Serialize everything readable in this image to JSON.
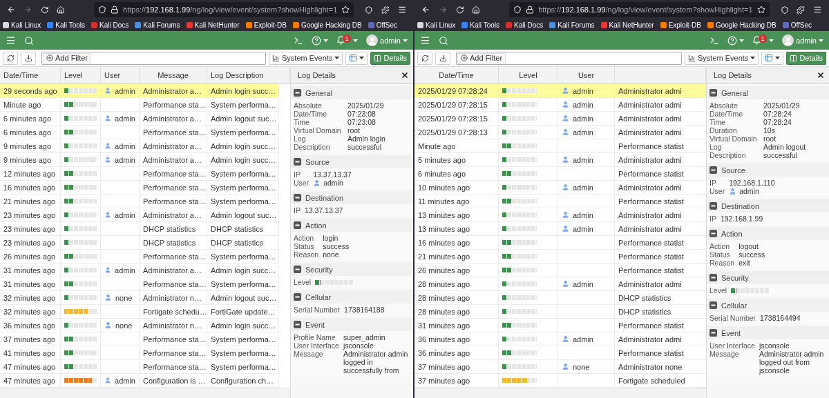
{
  "windows": [
    {
      "browser": {
        "url": "https://**192.168.1.99**/ng/log/view/event/system?showHighlight=1",
        "bookmarks": [
          {
            "label": "Kali Linux",
            "color": "#d9d9d9"
          },
          {
            "label": "Kali Tools",
            "color": "#3b82f6"
          },
          {
            "label": "Kali Docs",
            "color": "#d32f2f"
          },
          {
            "label": "Kali Forums",
            "color": "#4a90e2"
          },
          {
            "label": "Kali NetHunter",
            "color": "#e53935"
          },
          {
            "label": "Exploit-DB",
            "color": "#f57c00"
          },
          {
            "label": "Google Hacking DB",
            "color": "#f57c00"
          },
          {
            "label": "OffSec",
            "color": "#5c6bc0"
          }
        ]
      },
      "header": {
        "notifications": "1",
        "user": "admin"
      },
      "toolbar": {
        "filter_button": "Add Filter",
        "view_menu": "System Events",
        "details_button": "Details"
      },
      "table": {
        "columns": [
          "Date/Time",
          "Level",
          "User",
          "Message",
          "Log Description"
        ],
        "rows": [
          {
            "date": "29 seconds ago",
            "level": 0.143,
            "user": "admin",
            "message": "Administrator a…",
            "description": "Admin login succ…",
            "selected": true
          },
          {
            "date": "Minute ago",
            "level": 0.286,
            "message": "Performance sta…",
            "description": "System performa…",
            "selected": false
          },
          {
            "date": "6 minutes ago",
            "level": 0.143,
            "user": "admin",
            "message": "Administrator a…",
            "description": "Admin logout suc…",
            "selected": false
          },
          {
            "date": "6 minutes ago",
            "level": 0.286,
            "message": "Performance sta…",
            "description": "System performa…",
            "selected": false
          },
          {
            "date": "9 minutes ago",
            "level": 0.143,
            "user": "admin",
            "message": "Administrator a…",
            "description": "Admin login succ…",
            "selected": false
          },
          {
            "date": "9 minutes ago",
            "level": 0.143,
            "user": "admin",
            "message": "Administrator a…",
            "description": "Admin login succ…",
            "selected": false
          },
          {
            "date": "12 minutes ago",
            "level": 0.286,
            "message": "Performance sta…",
            "description": "System performa…",
            "selected": false
          },
          {
            "date": "16 minutes ago",
            "level": 0.286,
            "message": "Performance sta…",
            "description": "System performa…",
            "selected": false
          },
          {
            "date": "21 minutes ago",
            "level": 0.286,
            "message": "Performance sta…",
            "description": "System performa…",
            "selected": false
          },
          {
            "date": "23 minutes ago",
            "level": 0.143,
            "user": "admin",
            "message": "Administrator a…",
            "description": "Admin logout suc…",
            "selected": false
          },
          {
            "date": "23 minutes ago",
            "level": 0.143,
            "message": "DHCP statistics",
            "description": "DHCP statistics",
            "selected": false
          },
          {
            "date": "23 minutes ago",
            "level": 0.143,
            "message": "DHCP statistics",
            "description": "DHCP statistics",
            "selected": false
          },
          {
            "date": "26 minutes ago",
            "level": 0.286,
            "message": "Performance sta…",
            "description": "System performa…",
            "selected": false
          },
          {
            "date": "31 minutes ago",
            "level": 0.143,
            "user": "admin",
            "message": "Administrator a…",
            "description": "Admin login succ…",
            "selected": false
          },
          {
            "date": "31 minutes ago",
            "level": 0.286,
            "message": "Performance sta…",
            "description": "System performa…",
            "selected": false
          },
          {
            "date": "32 minutes ago",
            "level": 0.143,
            "user": "none",
            "message": "Administrator n…",
            "description": "Admin logout suc…",
            "selected": false
          },
          {
            "date": "32 minutes ago",
            "level": 0.714,
            "message": "Fortigate schedu…",
            "description": "FortiGate update…",
            "selected": false
          },
          {
            "date": "36 minutes ago",
            "level": 0.143,
            "user": "none",
            "message": "Administrator n…",
            "description": "Admin login succ…",
            "selected": false
          },
          {
            "date": "37 minutes ago",
            "level": 0.286,
            "message": "Performance sta…",
            "description": "System performa…",
            "selected": false
          },
          {
            "date": "41 minutes ago",
            "level": 0.286,
            "message": "Performance sta…",
            "description": "System performa…",
            "selected": false
          },
          {
            "date": "47 minutes ago",
            "level": 0.286,
            "message": "Performance sta…",
            "description": "System performa…",
            "selected": false
          },
          {
            "date": "47 minutes ago",
            "level": 0.857,
            "user": "admin",
            "message": "Configuration is …",
            "description": "Configuration ch…",
            "selected": false
          }
        ]
      },
      "details": {
        "title": "Log Details",
        "sections": [
          {
            "title": "General",
            "fields": [
              {
                "kind": "text",
                "label": "Absolute Date/Time",
                "value": "2025/01/29 07:23:08"
              },
              {
                "kind": "text",
                "label": "Time",
                "value": "07:23:08"
              },
              {
                "kind": "text",
                "label": "Virtual Domain",
                "value": "root"
              },
              {
                "kind": "text",
                "label": "Log Description",
                "value": "Admin login successful"
              }
            ]
          },
          {
            "title": "Source",
            "fields": [
              {
                "kind": "text",
                "label": "IP",
                "value": "13.37.13.37"
              },
              {
                "kind": "user",
                "label": "User",
                "value": "admin"
              }
            ]
          },
          {
            "title": "Destination",
            "fields": [
              {
                "kind": "text",
                "label": "IP",
                "value": "13.37.13.37"
              }
            ]
          },
          {
            "title": "Action",
            "fields": [
              {
                "kind": "text",
                "label": "Action",
                "value": "login"
              },
              {
                "kind": "text",
                "label": "Status",
                "value": "success"
              },
              {
                "kind": "text",
                "label": "Reason",
                "value": "none"
              }
            ]
          },
          {
            "title": "Security",
            "fields": [
              {
                "kind": "level",
                "label": "Level",
                "level": 0.143
              }
            ]
          },
          {
            "title": "Cellular",
            "fields": [
              {
                "kind": "text",
                "label": "Serial Number",
                "value": "1738164188"
              }
            ]
          },
          {
            "title": "Event",
            "fields": [
              {
                "kind": "text",
                "label": "Profile Name",
                "value": "super_admin"
              },
              {
                "kind": "text",
                "label": "User Interface",
                "value": "jsconsole"
              },
              {
                "kind": "text",
                "label": "Message",
                "value": "Administrator admin logged in successfully from"
              }
            ]
          }
        ]
      }
    },
    {
      "browser": {
        "url": "https://**192.168.1.99**/ng/log/view/event/system?showHighlight=1",
        "bookmarks": [
          {
            "label": "Kali Linux",
            "color": "#d9d9d9"
          },
          {
            "label": "Kali Tools",
            "color": "#3b82f6"
          },
          {
            "label": "Kali Docs",
            "color": "#d32f2f"
          },
          {
            "label": "Kali Forums",
            "color": "#4a90e2"
          },
          {
            "label": "Kali NetHunter",
            "color": "#e53935"
          },
          {
            "label": "Exploit-DB",
            "color": "#f57c00"
          },
          {
            "label": "Google Hacking DB",
            "color": "#f57c00"
          },
          {
            "label": "OffSec",
            "color": "#5c6bc0"
          }
        ]
      },
      "header": {
        "notifications": "1",
        "user": "admin"
      },
      "toolbar": {
        "filter_button": "Add Filter",
        "view_menu": "System Events",
        "details_button": "Details"
      },
      "table": {
        "columns": [
          "Date/Time",
          "Level",
          "User"
        ],
        "rows": [
          {
            "date": "2025/01/29 07:28:24",
            "level": 0.143,
            "user": "admin",
            "message": "Administrator admi",
            "selected": true
          },
          {
            "date": "2025/01/29 07:28:15",
            "level": 0.143,
            "user": "admin",
            "message": "Administrator admi",
            "selected": false
          },
          {
            "date": "2025/01/29 07:28:15",
            "level": 0.143,
            "user": "admin",
            "message": "Administrator admi",
            "selected": false
          },
          {
            "date": "2025/01/29 07:28:13",
            "level": 0.143,
            "user": "admin",
            "message": "Administrator admi",
            "selected": false
          },
          {
            "date": "Minute ago",
            "level": 0.286,
            "message": "Performance statist",
            "selected": false
          },
          {
            "date": "5 minutes ago",
            "level": 0.143,
            "user": "admin",
            "message": "Administrator admi",
            "selected": false
          },
          {
            "date": "6 minutes ago",
            "level": 0.286,
            "message": "Performance statist",
            "selected": false
          },
          {
            "date": "10 minutes ago",
            "level": 0.143,
            "user": "admin",
            "message": "Administrator admi",
            "selected": false
          },
          {
            "date": "11 minutes ago",
            "level": 0.286,
            "message": "Performance statist",
            "selected": false
          },
          {
            "date": "13 minutes ago",
            "level": 0.143,
            "user": "admin",
            "message": "Administrator admi",
            "selected": false
          },
          {
            "date": "13 minutes ago",
            "level": 0.143,
            "user": "admin",
            "message": "Administrator admi",
            "selected": false
          },
          {
            "date": "16 minutes ago",
            "level": 0.286,
            "message": "Performance statist",
            "selected": false
          },
          {
            "date": "21 minutes ago",
            "level": 0.286,
            "message": "Performance statist",
            "selected": false
          },
          {
            "date": "26 minutes ago",
            "level": 0.286,
            "message": "Performance statist",
            "selected": false
          },
          {
            "date": "28 minutes ago",
            "level": 0.143,
            "user": "admin",
            "message": "Administrator admi",
            "selected": false
          },
          {
            "date": "28 minutes ago",
            "level": 0.143,
            "message": "DHCP statistics",
            "selected": false
          },
          {
            "date": "28 minutes ago",
            "level": 0.143,
            "message": "DHCP statistics",
            "selected": false
          },
          {
            "date": "31 minutes ago",
            "level": 0.286,
            "message": "Performance statist",
            "selected": false
          },
          {
            "date": "36 minutes ago",
            "level": 0.143,
            "user": "admin",
            "message": "Administrator admi",
            "selected": false
          },
          {
            "date": "36 minutes ago",
            "level": 0.286,
            "message": "Performance statist",
            "selected": false
          },
          {
            "date": "37 minutes ago",
            "level": 0.143,
            "user": "none",
            "message": "Administrator none",
            "selected": false
          },
          {
            "date": "37 minutes ago",
            "level": 0.714,
            "message": "Fortigate scheduled",
            "selected": false
          }
        ]
      },
      "details": {
        "title": "Log Details",
        "sections": [
          {
            "title": "General",
            "fields": [
              {
                "kind": "text",
                "label": "Absolute Date/Time",
                "value": "2025/01/29 07:28:24"
              },
              {
                "kind": "text",
                "label": "Time",
                "value": "07:28:24"
              },
              {
                "kind": "text",
                "label": "Duration",
                "value": "10s"
              },
              {
                "kind": "text",
                "label": "Virtual Domain",
                "value": "root"
              },
              {
                "kind": "text",
                "label": "Log Description",
                "value": "Admin logout successful"
              }
            ]
          },
          {
            "title": "Source",
            "fields": [
              {
                "kind": "text",
                "label": "IP",
                "value": "192.168.1.110"
              },
              {
                "kind": "user",
                "label": "User",
                "value": "admin"
              }
            ]
          },
          {
            "title": "Destination",
            "fields": [
              {
                "kind": "text",
                "label": "IP",
                "value": "192.168.1.99"
              }
            ]
          },
          {
            "title": "Action",
            "fields": [
              {
                "kind": "text",
                "label": "Action",
                "value": "logout"
              },
              {
                "kind": "text",
                "label": "Status",
                "value": "success"
              },
              {
                "kind": "text",
                "label": "Reason",
                "value": "exit"
              }
            ]
          },
          {
            "title": "Security",
            "fields": [
              {
                "kind": "level",
                "label": "Level",
                "level": 0.143
              }
            ]
          },
          {
            "title": "Cellular",
            "fields": [
              {
                "kind": "text",
                "label": "Serial Number",
                "value": "1738164494"
              }
            ]
          },
          {
            "title": "Event",
            "fields": [
              {
                "kind": "text",
                "label": "User Interface",
                "value": "jsconsole"
              },
              {
                "kind": "text",
                "label": "Message",
                "value": "Administrator admin logged out from jsconsole"
              }
            ]
          }
        ]
      }
    }
  ]
}
